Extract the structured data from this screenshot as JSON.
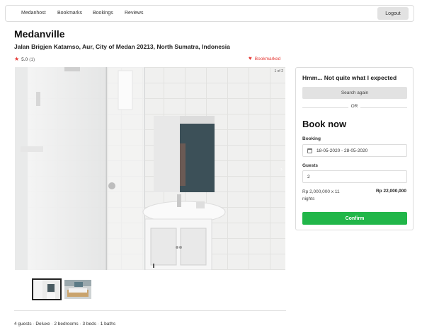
{
  "nav": {
    "links": [
      "Medanhost",
      "Bookmarks",
      "Bookings",
      "Reviews"
    ],
    "logout_label": "Logout"
  },
  "listing": {
    "title": "Medanville",
    "address": "Jalan Brigjen Katamso, Aur, City of Medan 20213, North Sumatra, Indonesia",
    "rating": "5.0",
    "review_count": "(1)",
    "bookmark_label": "Bookmarked",
    "features": "4 guests · Deluxe · 2 bedrooms · 3 beds · 1 baths"
  },
  "gallery": {
    "counter": "1 of 2",
    "next_icon": "chevron-right-icon"
  },
  "panel": {
    "unexpected_heading": "Hmm... Not quite what I expected",
    "search_again_label": "Search again",
    "or_label": "OR",
    "book_now_heading": "Book now",
    "booking_label": "Booking",
    "date_range": "18-05-2020 - 28-05-2020",
    "guests_label": "Guests",
    "guests_value": "2",
    "price_calc": "Rp 2,000,000 x 11 nights",
    "price_total": "Rp 22,000,000",
    "confirm_label": "Confirm"
  },
  "colors": {
    "accent_red": "#e53935",
    "confirm_green": "#21b649",
    "button_gray": "#e2e2e2"
  }
}
